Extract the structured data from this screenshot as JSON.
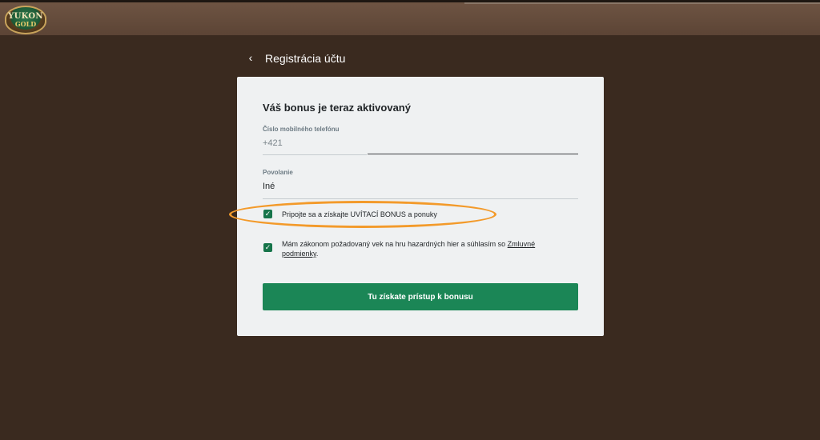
{
  "header": {
    "logo_top": "YUKON",
    "logo_bottom": "GOLD"
  },
  "nav": {
    "back_icon": "chevron-left-icon",
    "title": "Registrácia účtu"
  },
  "form": {
    "heading": "Váš bonus je teraz aktivovaný",
    "phone": {
      "label": "Číslo mobilného telefónu",
      "prefix": "+421",
      "value": ""
    },
    "occupation": {
      "label": "Povolanie",
      "selected": "Iné"
    },
    "bonus_checkbox": {
      "checked": true,
      "label": "Pripojte sa a získajte UVÍTACÍ BONUS a ponuky"
    },
    "terms_checkbox": {
      "checked": true,
      "text_before": "Mám zákonom požadovaný vek na hru hazardných hier a súhlasím so ",
      "link_text": "Zmluvné podmienky",
      "text_after": "."
    },
    "submit_label": "Tu získate prístup k bonusu"
  },
  "colors": {
    "background": "#3a2a1f",
    "header": "#6e5443",
    "card": "#eff1f2",
    "accent_green": "#1b8656",
    "highlight_orange": "#f39a2a"
  }
}
